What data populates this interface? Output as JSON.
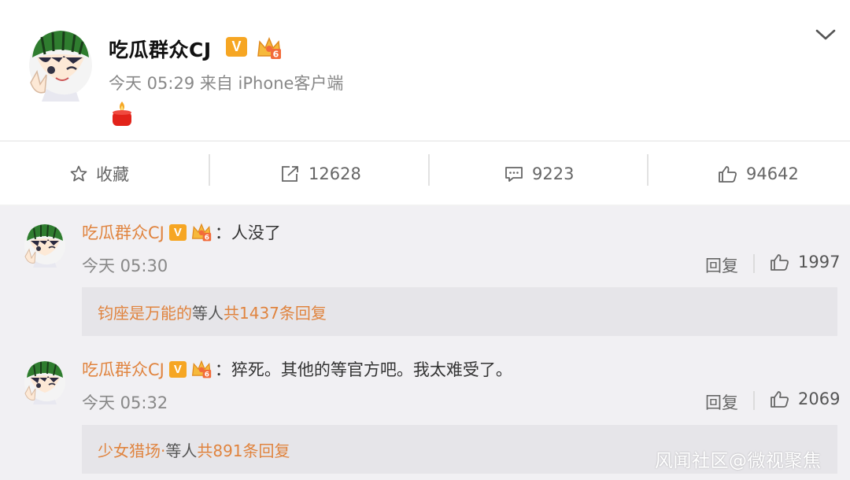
{
  "post": {
    "user_name": "吃瓜群众CJ",
    "verified_badge": "V",
    "crown_level": "6",
    "meta": "今天 05:29 来自 iPhone客户端",
    "content_emoji": "candle-emoji",
    "expand_icon": "chevron-down-icon"
  },
  "actions": {
    "favorite_label": "收藏",
    "repost_count": "12628",
    "comment_count": "9223",
    "like_count": "94642"
  },
  "comments": [
    {
      "user_name": "吃瓜群众CJ",
      "verified_badge": "V",
      "crown_level": "6",
      "separator": "：",
      "text": "人没了",
      "time": "今天 05:30",
      "reply_label": "回复",
      "likes": "1997",
      "sub_reply": {
        "name": "钧座是万能的",
        "middle": " 等人 ",
        "total": "共1437条回复"
      }
    },
    {
      "user_name": "吃瓜群众CJ",
      "verified_badge": "V",
      "crown_level": "6",
      "separator": "：",
      "text": "猝死。其他的等官方吧。我太难受了。",
      "time": "今天 05:32",
      "reply_label": "回复",
      "likes": "2069",
      "sub_reply": {
        "name": "少女猎场·",
        "middle": " 等人 ",
        "total": "共891条回复"
      }
    }
  ],
  "watermark": "风闻社区@微视聚焦",
  "colors": {
    "name_orange": "#e0843f",
    "badge_orange": "#f6a623",
    "comment_bg": "#f1f0f3"
  }
}
